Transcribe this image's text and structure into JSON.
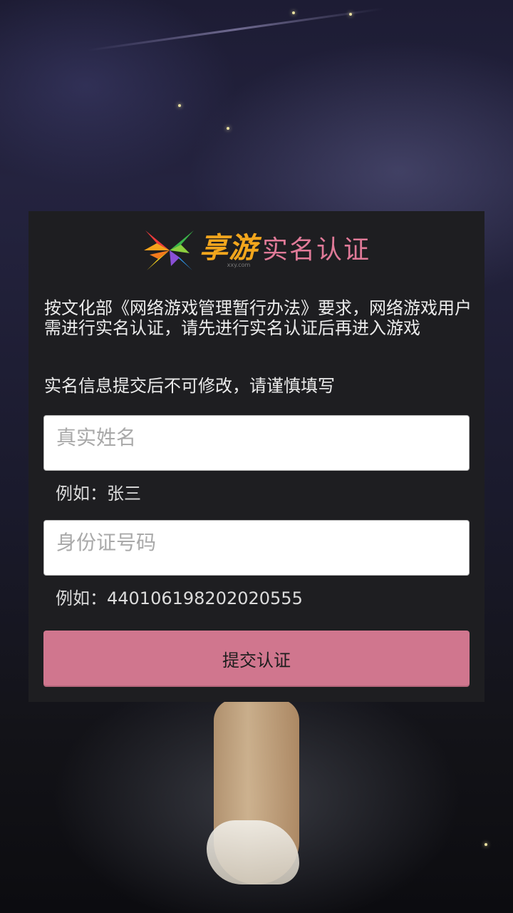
{
  "header": {
    "brand": "享游",
    "domain": "xxy.com",
    "title": "实名认证"
  },
  "notice": "按文化部《网络游戏管理暂行办法》要求，网络游戏用户需进行实名认证，请先进行实名认证后再进入游戏",
  "warning": "实名信息提交后不可修改，请谨慎填写",
  "form": {
    "name_placeholder": "真实姓名",
    "name_value": "",
    "name_hint": "例如：张三",
    "id_placeholder": "身份证号码",
    "id_value": "",
    "id_hint": "例如：440106198202020555",
    "submit_label": "提交认证"
  },
  "colors": {
    "accent": "#d0768e",
    "title": "#e07a98",
    "brand": "#f2a61d",
    "dialog_bg": "#1e1e21"
  },
  "icons": {
    "logo": "pinwheel-x-logo-icon"
  }
}
